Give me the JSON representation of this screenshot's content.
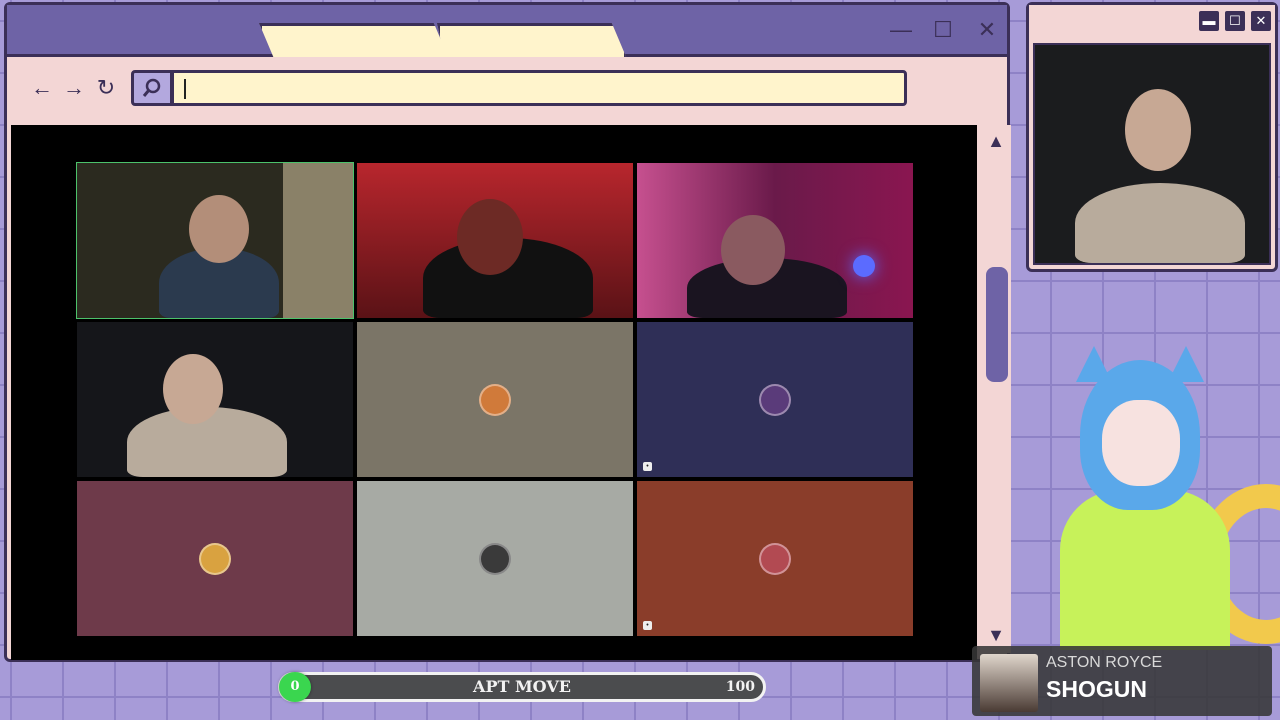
{
  "browser": {
    "tabs": [
      "",
      ""
    ],
    "window_controls": {
      "minimize": "—",
      "maximize": "☐",
      "close": "✕"
    },
    "nav": {
      "back": "←",
      "forward": "→",
      "reload": "↻"
    },
    "url": {
      "value": "",
      "placeholder": ""
    }
  },
  "call": {
    "tiles": [
      {
        "type": "video",
        "active": true,
        "bg": "#2b2a1f"
      },
      {
        "type": "video",
        "active": false,
        "bg": "#5a1216"
      },
      {
        "type": "video",
        "active": false,
        "bg": "#4a1630"
      },
      {
        "type": "video",
        "active": false,
        "bg": "#15161a"
      },
      {
        "type": "avatar",
        "bg": "#7b7567",
        "avatar_color": "#d07a3a"
      },
      {
        "type": "avatar",
        "bg": "#2f2f57",
        "avatar_color": "#5a3b7a"
      },
      {
        "type": "avatar",
        "bg": "#6e3a4a",
        "avatar_color": "#d9a240"
      },
      {
        "type": "avatar",
        "bg": "#a7aaa4",
        "avatar_color": "#3a3a3a"
      },
      {
        "type": "avatar",
        "bg": "#8a3d2a",
        "avatar_color": "#b24a52"
      }
    ]
  },
  "scrollbar": {
    "up": "▲",
    "down": "▼"
  },
  "cam": {
    "controls": {
      "minimize": "▬",
      "maximize": "☐",
      "close": "✕"
    }
  },
  "progress": {
    "value_label": "0",
    "label": "APT MOVE",
    "max_label": "100",
    "fraction": 0.0
  },
  "now_playing": {
    "artist": "ASTON ROYCE",
    "title": "SHOGUN"
  }
}
